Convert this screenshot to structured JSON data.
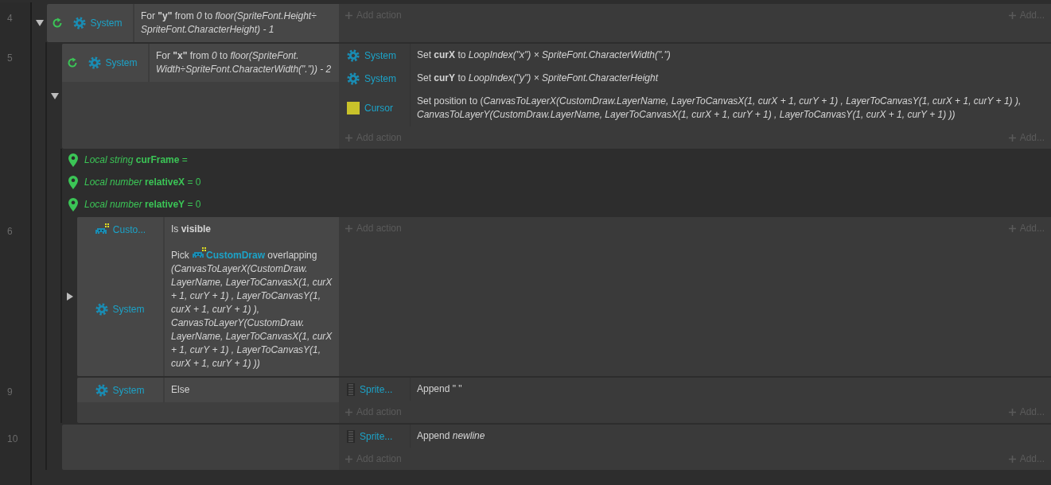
{
  "events": [
    {
      "kind": "event",
      "number": "4",
      "expanded": true,
      "conditions": [
        {
          "object": "System",
          "kind": "gear",
          "loop": true,
          "text": "For **\"y\"** from *0* to *floor(SpriteFont.Height÷ SpriteFont.CharacterHeight) - 1*"
        }
      ],
      "add_action": "Add action",
      "add_other": "Add...",
      "children": [
        {
          "kind": "event",
          "number": "5",
          "expanded": true,
          "conditions": [
            {
              "object": "System",
              "kind": "gear",
              "loop": true,
              "text": "For **\"x\"** from *0* to *floor(SpriteFont. Width÷SpriteFont.CharacterWidth(\".\")) - 2*"
            }
          ],
          "actions": [
            {
              "object": "System",
              "kind": "gear",
              "text": "Set **curX** to *LoopIndex(\"x\") × SpriteFont.CharacterWidth(\".\")*"
            },
            {
              "object": "System",
              "kind": "gear",
              "text": "Set **curY** to *LoopIndex(\"y\") × SpriteFont.CharacterHeight*"
            },
            {
              "object": "Cursor",
              "kind": "swatch",
              "text": "Set position to (*CanvasToLayerX(CustomDraw.LayerName, LayerToCanvasX(1, curX + 1, curY + 1) , LayerToCanvasY(1, curX + 1, curY + 1) ), CanvasToLayerY(CustomDraw.LayerName, LayerToCanvasX(1, curX + 1, curY + 1) , LayerToCanvasY(1, curX + 1, curY + 1) ))*"
            }
          ],
          "add_action": "Add action",
          "add_other": "Add...",
          "children": [
            {
              "kind": "variable",
              "text": "*Local string* **curFrame** ="
            },
            {
              "kind": "variable",
              "text": "*Local number* **relativeX** = 0"
            },
            {
              "kind": "variable",
              "text": "*Local number* **relativeY** = 0"
            },
            {
              "kind": "event",
              "number": "6",
              "expanded": false,
              "conditions": [
                {
                  "object": "Custo...",
                  "kind": "invader",
                  "loop": false,
                  "text": "Is **visible**"
                },
                {
                  "object": "System",
                  "kind": "gear",
                  "loop": false,
                  "text": "Pick",
                  "object_ref": {
                    "name": "CustomDraw",
                    "kind": "invader"
                  },
                  "text_after": "overlapping *(CanvasToLayerX(CustomDraw. LayerName, LayerToCanvasX(1, curX + 1, curY + 1) , LayerToCanvasY(1, curX + 1, curY + 1) ), CanvasToLayerY(CustomDraw. LayerName, LayerToCanvasX(1, curX + 1, curY + 1) , LayerToCanvasY(1, curX + 1, curY + 1) ))*"
                }
              ],
              "add_action": "Add action",
              "add_other": "Add..."
            },
            {
              "kind": "event",
              "number": "9",
              "conditions": [
                {
                  "object": "System",
                  "kind": "gear",
                  "loop": false,
                  "text": "Else"
                }
              ],
              "actions": [
                {
                  "object": "Sprite...",
                  "kind": "spritefont",
                  "text": "Append \" \""
                }
              ],
              "add_action": "Add action",
              "add_other": "Add..."
            }
          ]
        },
        {
          "kind": "event",
          "number": "10",
          "actions": [
            {
              "object": "Sprite...",
              "kind": "spritefont",
              "text": "Append *newline*"
            }
          ],
          "add_action": "Add action",
          "add_other": "Add..."
        }
      ]
    }
  ]
}
